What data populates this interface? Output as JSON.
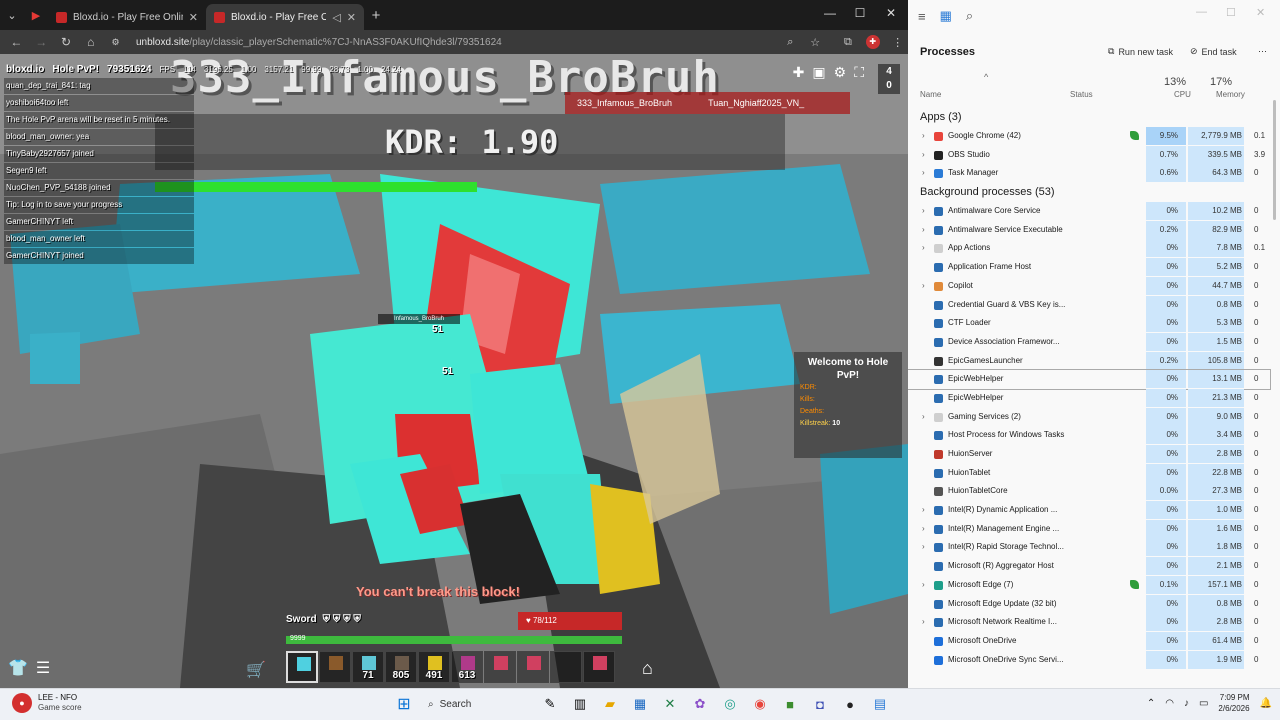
{
  "browser": {
    "tabs": [
      {
        "label": "Bloxd.io - Play Free Online Gam",
        "active": false
      },
      {
        "label": "Bloxd.io - Play Free Online",
        "active": true
      }
    ],
    "url_host": "unbloxd.site",
    "url_path": "/play/classic_playerSchematic%7CJ-NnAS3F0AKUfIQhde3l/79351624"
  },
  "game": {
    "hud": {
      "logo": "bloxd.io",
      "mode": "Hole PvP!",
      "lobby_id": "79351624",
      "fps_label": "FPS",
      "fps": "114",
      "stats": [
        "3196.25",
        "1.00",
        "3157.21",
        "99.99",
        "28.73",
        "1.00",
        "24.24"
      ]
    },
    "big_name": "333_Infamous_BroBruh",
    "kdr_text": "KDR: 1.90",
    "killfeed": {
      "killer": "333_Infamous_BroBruh",
      "victim": "Tuan_Nghiaff2025_VN_"
    },
    "chat": [
      "quan_dep_trai_841: tag",
      "yoshiboi64too left",
      "The Hole PvP arena will be reset in 5 minutes.",
      "blood_man_owner: yea",
      "TinyBaby2927657 joined",
      "Segen9 left",
      "NuoChen_PVP_54188 joined",
      "Tip: Log in to save your progress",
      "GamerCHINYT left",
      "blood_man_owner left",
      "GamerCHINYT joined"
    ],
    "score_badge": {
      "top": "4",
      "bottom": "0"
    },
    "welcome": {
      "title": "Welcome to Hole PvP!",
      "kdr_label": "KDR:",
      "kills_label": "Kills:",
      "deaths_label": "Deaths:",
      "killstreak_label": "Killstreak:",
      "killstreak": "10"
    },
    "enemy_nametag": "Infamous_BroBruh",
    "damage": [
      "51",
      "51"
    ],
    "cant_break": "You can't break this block!",
    "held_item": "Sword",
    "hp_text": "78/112",
    "xp_text": "9999",
    "hotbar": [
      {
        "count": "",
        "color": "#4fd0e0"
      },
      {
        "count": "",
        "color": "#8a5a2b"
      },
      {
        "count": "71",
        "color": "#5fc7d6"
      },
      {
        "count": "805",
        "color": "#6b5a4a"
      },
      {
        "count": "491",
        "color": "#e0c020"
      },
      {
        "count": "613",
        "color": "#b03a8a"
      },
      {
        "count": "",
        "color": "#d04060"
      },
      {
        "count": "",
        "color": "#d04060"
      },
      {
        "count": "",
        "color": ""
      },
      {
        "count": "",
        "color": "#d04060"
      }
    ]
  },
  "taskmanager": {
    "section_title": "Processes",
    "run_new_task": "Run new task",
    "end_task": "End task",
    "col_name": "Name",
    "col_status": "Status",
    "col_cpu": "CPU",
    "col_memory": "Memory",
    "cpu_pct": "13%",
    "mem_pct": "17%",
    "apps_header": "Apps (3)",
    "bg_header": "Background processes (53)",
    "apps": [
      {
        "name": "Google Chrome (42)",
        "cpu": "9.5%",
        "mem": "2,779.9 MB",
        "extra": "0.1",
        "icon": "#e8453c",
        "expand": true,
        "leaf": true
      },
      {
        "name": "OBS Studio",
        "cpu": "0.7%",
        "mem": "339.5 MB",
        "extra": "3.9",
        "icon": "#222",
        "expand": true
      },
      {
        "name": "Task Manager",
        "cpu": "0.6%",
        "mem": "64.3 MB",
        "extra": "0",
        "icon": "#2b7bd6",
        "expand": true
      }
    ],
    "background": [
      {
        "name": "Antimalware Core Service",
        "cpu": "0%",
        "mem": "10.2 MB",
        "extra": "0",
        "icon": "#2b6cb0",
        "expand": true
      },
      {
        "name": "Antimalware Service Executable",
        "cpu": "0.2%",
        "mem": "82.9 MB",
        "extra": "0",
        "icon": "#2b6cb0",
        "expand": true
      },
      {
        "name": "App Actions",
        "cpu": "0%",
        "mem": "7.8 MB",
        "extra": "0.1",
        "icon": "#cfcfcf",
        "expand": true
      },
      {
        "name": "Application Frame Host",
        "cpu": "0%",
        "mem": "5.2 MB",
        "extra": "0",
        "icon": "#2b6cb0"
      },
      {
        "name": "Copilot",
        "cpu": "0%",
        "mem": "44.7 MB",
        "extra": "0",
        "icon": "#e08a3a",
        "expand": true
      },
      {
        "name": "Credential Guard & VBS Key is...",
        "cpu": "0%",
        "mem": "0.8 MB",
        "extra": "0",
        "icon": "#2b6cb0"
      },
      {
        "name": "CTF Loader",
        "cpu": "0%",
        "mem": "5.3 MB",
        "extra": "0",
        "icon": "#2b6cb0"
      },
      {
        "name": "Device Association Framewor...",
        "cpu": "0%",
        "mem": "1.5 MB",
        "extra": "0",
        "icon": "#2b6cb0"
      },
      {
        "name": "EpicGamesLauncher",
        "cpu": "0.2%",
        "mem": "105.8 MB",
        "extra": "0",
        "icon": "#333"
      },
      {
        "name": "EpicWebHelper",
        "cpu": "0%",
        "mem": "13.1 MB",
        "extra": "0",
        "icon": "#2b6cb0",
        "selected": true
      },
      {
        "name": "EpicWebHelper",
        "cpu": "0%",
        "mem": "21.3 MB",
        "extra": "0",
        "icon": "#2b6cb0"
      },
      {
        "name": "Gaming Services (2)",
        "cpu": "0%",
        "mem": "9.0 MB",
        "extra": "0",
        "icon": "#cfcfcf",
        "expand": true
      },
      {
        "name": "Host Process for Windows Tasks",
        "cpu": "0%",
        "mem": "3.4 MB",
        "extra": "0",
        "icon": "#2b6cb0"
      },
      {
        "name": "HuionServer",
        "cpu": "0%",
        "mem": "2.8 MB",
        "extra": "0",
        "icon": "#c0392b"
      },
      {
        "name": "HuionTablet",
        "cpu": "0%",
        "mem": "22.8 MB",
        "extra": "0",
        "icon": "#2b6cb0"
      },
      {
        "name": "HuionTabletCore",
        "cpu": "0.0%",
        "mem": "27.3 MB",
        "extra": "0",
        "icon": "#555"
      },
      {
        "name": "Intel(R) Dynamic Application ...",
        "cpu": "0%",
        "mem": "1.0 MB",
        "extra": "0",
        "icon": "#2b6cb0",
        "expand": true
      },
      {
        "name": "Intel(R) Management Engine ...",
        "cpu": "0%",
        "mem": "1.6 MB",
        "extra": "0",
        "icon": "#2b6cb0",
        "expand": true
      },
      {
        "name": "Intel(R) Rapid Storage Technol...",
        "cpu": "0%",
        "mem": "1.8 MB",
        "extra": "0",
        "icon": "#2b6cb0",
        "expand": true
      },
      {
        "name": "Microsoft (R) Aggregator Host",
        "cpu": "0%",
        "mem": "2.1 MB",
        "extra": "0",
        "icon": "#2b6cb0"
      },
      {
        "name": "Microsoft Edge (7)",
        "cpu": "0.1%",
        "mem": "157.1 MB",
        "extra": "0",
        "icon": "#1e9e8a",
        "expand": true,
        "leaf": true
      },
      {
        "name": "Microsoft Edge Update (32 bit)",
        "cpu": "0%",
        "mem": "0.8 MB",
        "extra": "0",
        "icon": "#2b6cb0"
      },
      {
        "name": "Microsoft Network Realtime I...",
        "cpu": "0%",
        "mem": "2.8 MB",
        "extra": "0",
        "icon": "#2b6cb0",
        "expand": true
      },
      {
        "name": "Microsoft OneDrive",
        "cpu": "0%",
        "mem": "61.4 MB",
        "extra": "0",
        "icon": "#1e6fd9"
      },
      {
        "name": "Microsoft OneDrive Sync Servi...",
        "cpu": "0%",
        "mem": "1.9 MB",
        "extra": "0",
        "icon": "#1e6fd9"
      }
    ]
  },
  "taskbar": {
    "notif_title": "LEE - NFO",
    "notif_sub": "Game score",
    "search": "Search",
    "time": "7:09 PM",
    "date": "2/6/2026"
  },
  "colors": {
    "accent": "#0067c0",
    "cpu_heat": "#cde6fb",
    "cpu_heat_hi": "#a9d3f8"
  },
  "icons": [
    "search-icon",
    "back-icon",
    "forward-icon",
    "reload-icon",
    "home-icon",
    "star-icon",
    "gear-icon",
    "close-icon",
    "windows-logo-icon",
    "wifi-icon",
    "volume-icon",
    "battery-icon"
  ]
}
